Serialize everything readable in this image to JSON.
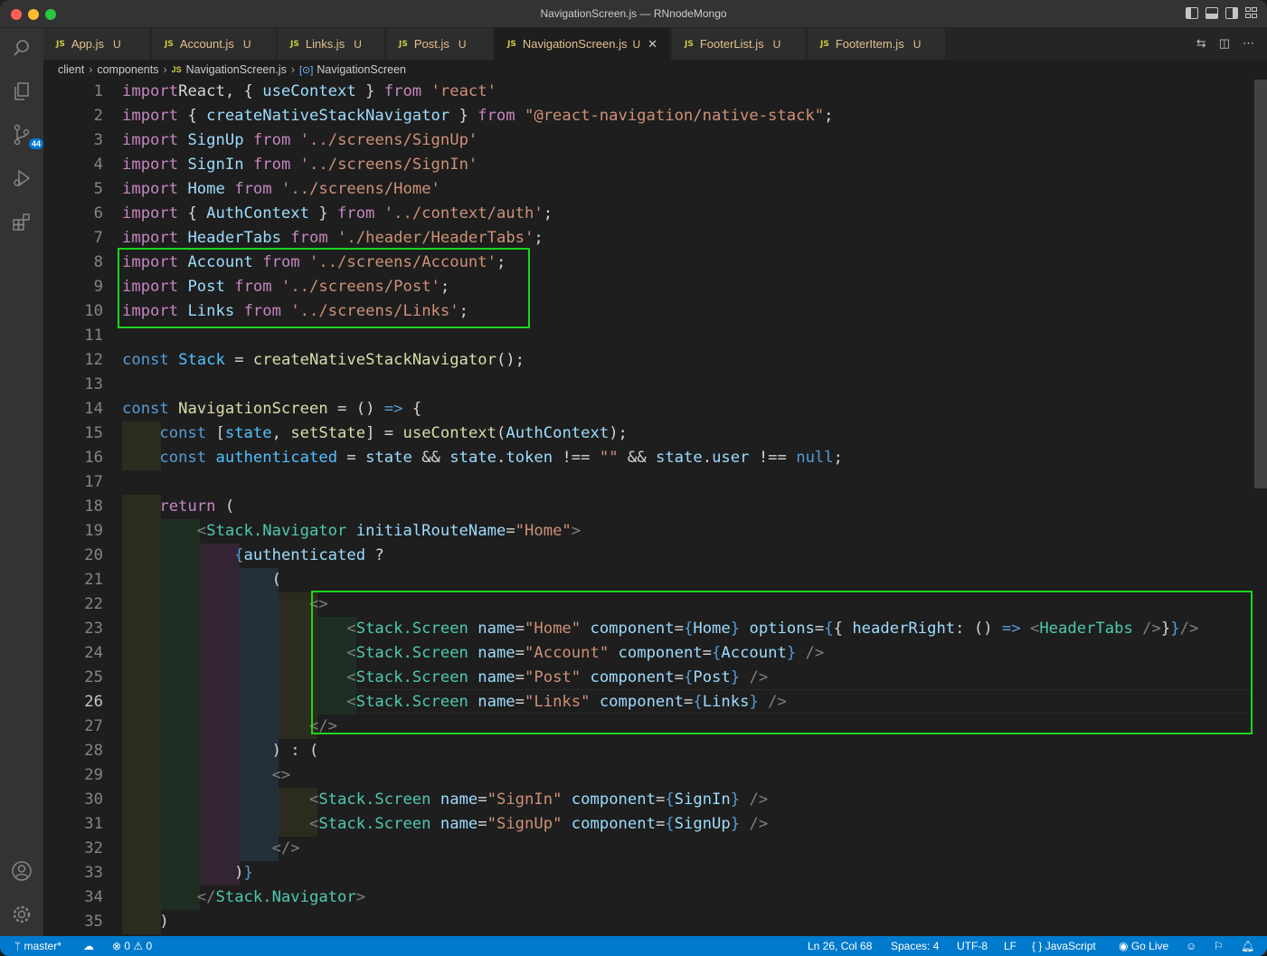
{
  "window": {
    "title": "NavigationScreen.js — RNnodeMongo"
  },
  "activity": {
    "scm_badge": "44"
  },
  "tabs": [
    {
      "label": "App.js",
      "status": "U"
    },
    {
      "label": "Account.js",
      "status": "U"
    },
    {
      "label": "Links.js",
      "status": "U"
    },
    {
      "label": "Post.js",
      "status": "U"
    },
    {
      "label": "NavigationScreen.js",
      "status": "U"
    },
    {
      "label": "FooterList.js",
      "status": "U"
    },
    {
      "label": "FooterItem.js",
      "status": "U"
    }
  ],
  "tab_file_icon": "JS",
  "breadcrumb": [
    "client",
    "components",
    "NavigationScreen.js",
    "NavigationScreen"
  ],
  "editor": {
    "line_numbers": [
      "1",
      "2",
      "3",
      "4",
      "5",
      "6",
      "7",
      "8",
      "9",
      "10",
      "11",
      "12",
      "13",
      "14",
      "15",
      "16",
      "17",
      "18",
      "19",
      "20",
      "21",
      "22",
      "23",
      "24",
      "25",
      "26",
      "27",
      "28",
      "29",
      "30",
      "31",
      "32",
      "33",
      "34",
      "35"
    ],
    "lines": [
      [
        [
          "imp",
          "import"
        ],
        [
          "",
          "React, { "
        ],
        [
          "v",
          "useContext"
        ],
        [
          "",
          " } "
        ],
        [
          "imp",
          "from"
        ],
        [
          "",
          " "
        ],
        [
          "s",
          "'react'"
        ]
      ],
      [
        [
          "imp",
          "import"
        ],
        [
          "",
          " { "
        ],
        [
          "v",
          "createNativeStackNavigator"
        ],
        [
          "",
          " } "
        ],
        [
          "imp",
          "from"
        ],
        [
          "",
          " "
        ],
        [
          "s",
          "\"@react-navigation/native-stack\""
        ],
        [
          "",
          ";"
        ]
      ],
      [
        [
          "imp",
          "import"
        ],
        [
          "",
          " "
        ],
        [
          "v",
          "SignUp"
        ],
        [
          "",
          " "
        ],
        [
          "imp",
          "from"
        ],
        [
          "",
          " "
        ],
        [
          "s",
          "'../screens/SignUp'"
        ]
      ],
      [
        [
          "imp",
          "import"
        ],
        [
          "",
          " "
        ],
        [
          "v",
          "SignIn"
        ],
        [
          "",
          " "
        ],
        [
          "imp",
          "from"
        ],
        [
          "",
          " "
        ],
        [
          "s",
          "'../screens/SignIn'"
        ]
      ],
      [
        [
          "imp",
          "import"
        ],
        [
          "",
          " "
        ],
        [
          "v",
          "Home"
        ],
        [
          "",
          " "
        ],
        [
          "imp",
          "from"
        ],
        [
          "",
          " "
        ],
        [
          "s",
          "'../screens/Home'"
        ]
      ],
      [
        [
          "imp",
          "import"
        ],
        [
          "",
          " { "
        ],
        [
          "v",
          "AuthContext"
        ],
        [
          "",
          " } "
        ],
        [
          "imp",
          "from"
        ],
        [
          "",
          " "
        ],
        [
          "s",
          "'../context/auth'"
        ],
        [
          "",
          ";"
        ]
      ],
      [
        [
          "imp",
          "import"
        ],
        [
          "",
          " "
        ],
        [
          "v",
          "HeaderTabs"
        ],
        [
          "",
          " "
        ],
        [
          "imp",
          "from"
        ],
        [
          "",
          " "
        ],
        [
          "s",
          "'./header/HeaderTabs'"
        ],
        [
          "",
          ";"
        ]
      ],
      [
        [
          "imp",
          "import"
        ],
        [
          "",
          " "
        ],
        [
          "v",
          "Account"
        ],
        [
          "",
          " "
        ],
        [
          "imp",
          "from"
        ],
        [
          "",
          " "
        ],
        [
          "s",
          "'../screens/Account'"
        ],
        [
          "",
          ";"
        ]
      ],
      [
        [
          "imp",
          "import"
        ],
        [
          "",
          " "
        ],
        [
          "v",
          "Post"
        ],
        [
          "",
          " "
        ],
        [
          "imp",
          "from"
        ],
        [
          "",
          " "
        ],
        [
          "s",
          "'../screens/Post'"
        ],
        [
          "",
          ";"
        ]
      ],
      [
        [
          "imp",
          "import"
        ],
        [
          "",
          " "
        ],
        [
          "v",
          "Links"
        ],
        [
          "",
          " "
        ],
        [
          "imp",
          "from"
        ],
        [
          "",
          " "
        ],
        [
          "s",
          "'../screens/Links'"
        ],
        [
          "",
          ";"
        ]
      ],
      [],
      [
        [
          "k",
          "const"
        ],
        [
          "",
          " "
        ],
        [
          "c",
          "Stack"
        ],
        [
          "",
          " = "
        ],
        [
          "f",
          "createNativeStackNavigator"
        ],
        [
          "",
          "();"
        ]
      ],
      [],
      [
        [
          "k",
          "const"
        ],
        [
          "",
          " "
        ],
        [
          "f",
          "NavigationScreen"
        ],
        [
          "",
          " = () "
        ],
        [
          "k",
          "=>"
        ],
        [
          "",
          " {"
        ]
      ],
      [
        [
          "",
          "    "
        ],
        [
          "k",
          "const"
        ],
        [
          "",
          " ["
        ],
        [
          "c",
          "state"
        ],
        [
          "",
          ", "
        ],
        [
          "f",
          "setState"
        ],
        [
          "",
          "] = "
        ],
        [
          "f",
          "useContext"
        ],
        [
          "",
          "("
        ],
        [
          "v",
          "AuthContext"
        ],
        [
          "",
          ");"
        ]
      ],
      [
        [
          "",
          "    "
        ],
        [
          "k",
          "const"
        ],
        [
          "",
          " "
        ],
        [
          "c",
          "authenticated"
        ],
        [
          "",
          " = "
        ],
        [
          "v",
          "state"
        ],
        [
          "",
          " && "
        ],
        [
          "v",
          "state"
        ],
        [
          "",
          "."
        ],
        [
          "v",
          "token"
        ],
        [
          "",
          " !== "
        ],
        [
          "s",
          "\"\""
        ],
        [
          "",
          " && "
        ],
        [
          "v",
          "state"
        ],
        [
          "",
          "."
        ],
        [
          "v",
          "user"
        ],
        [
          "",
          " !== "
        ],
        [
          "k",
          "null"
        ],
        [
          "",
          ";"
        ]
      ],
      [],
      [
        [
          "",
          "    "
        ],
        [
          "imp",
          "return"
        ],
        [
          "",
          " ("
        ]
      ],
      [
        [
          "",
          "        "
        ],
        [
          "tag",
          "<"
        ],
        [
          "t",
          "Stack.Navigator"
        ],
        [
          "",
          " "
        ],
        [
          "v",
          "initialRouteName"
        ],
        [
          "",
          "="
        ],
        [
          "s",
          "\"Home\""
        ],
        [
          "tag",
          ">"
        ]
      ],
      [
        [
          "",
          "            "
        ],
        [
          "k",
          "{"
        ],
        [
          "v",
          "authenticated"
        ],
        [
          "",
          " ?"
        ]
      ],
      [
        [
          "",
          "                ("
        ]
      ],
      [
        [
          "",
          "                    "
        ],
        [
          "tag",
          "<>"
        ]
      ],
      [
        [
          "",
          "                        "
        ],
        [
          "tag",
          "<"
        ],
        [
          "t",
          "Stack.Screen"
        ],
        [
          "",
          " "
        ],
        [
          "v",
          "name"
        ],
        [
          "",
          "="
        ],
        [
          "s",
          "\"Home\""
        ],
        [
          "",
          " "
        ],
        [
          "v",
          "component"
        ],
        [
          "",
          "="
        ],
        [
          "k",
          "{"
        ],
        [
          "v",
          "Home"
        ],
        [
          "k",
          "}"
        ],
        [
          "",
          " "
        ],
        [
          "v",
          "options"
        ],
        [
          "",
          "="
        ],
        [
          "k",
          "{"
        ],
        [
          "",
          "{ "
        ],
        [
          "v",
          "headerRight"
        ],
        [
          "",
          ": () "
        ],
        [
          "k",
          "=>"
        ],
        [
          "",
          " "
        ],
        [
          "tag",
          "<"
        ],
        [
          "t",
          "HeaderTabs"
        ],
        [
          "",
          " "
        ],
        [
          "tag",
          "/>"
        ],
        [
          "",
          "}"
        ],
        [
          "k",
          "}"
        ],
        [
          "tag",
          "/>"
        ]
      ],
      [
        [
          "",
          "                        "
        ],
        [
          "tag",
          "<"
        ],
        [
          "t",
          "Stack.Screen"
        ],
        [
          "",
          " "
        ],
        [
          "v",
          "name"
        ],
        [
          "",
          "="
        ],
        [
          "s",
          "\"Account\""
        ],
        [
          "",
          " "
        ],
        [
          "v",
          "component"
        ],
        [
          "",
          "="
        ],
        [
          "k",
          "{"
        ],
        [
          "v",
          "Account"
        ],
        [
          "k",
          "}"
        ],
        [
          "",
          " "
        ],
        [
          "tag",
          "/>"
        ]
      ],
      [
        [
          "",
          "                        "
        ],
        [
          "tag",
          "<"
        ],
        [
          "t",
          "Stack.Screen"
        ],
        [
          "",
          " "
        ],
        [
          "v",
          "name"
        ],
        [
          "",
          "="
        ],
        [
          "s",
          "\"Post\""
        ],
        [
          "",
          " "
        ],
        [
          "v",
          "component"
        ],
        [
          "",
          "="
        ],
        [
          "k",
          "{"
        ],
        [
          "v",
          "Post"
        ],
        [
          "k",
          "}"
        ],
        [
          "",
          " "
        ],
        [
          "tag",
          "/>"
        ]
      ],
      [
        [
          "",
          "                        "
        ],
        [
          "tag",
          "<"
        ],
        [
          "t",
          "Stack.Screen"
        ],
        [
          "",
          " "
        ],
        [
          "v",
          "name"
        ],
        [
          "",
          "="
        ],
        [
          "s",
          "\"Links\""
        ],
        [
          "",
          " "
        ],
        [
          "v",
          "component"
        ],
        [
          "",
          "="
        ],
        [
          "k",
          "{"
        ],
        [
          "v",
          "Links"
        ],
        [
          "k",
          "}"
        ],
        [
          "",
          " "
        ],
        [
          "tag",
          "/>"
        ]
      ],
      [
        [
          "",
          "                    "
        ],
        [
          "tag",
          "</>"
        ]
      ],
      [
        [
          "",
          "                ) : ("
        ]
      ],
      [
        [
          "",
          "                "
        ],
        [
          "tag",
          "<>"
        ]
      ],
      [
        [
          "",
          "                    "
        ],
        [
          "tag",
          "<"
        ],
        [
          "t",
          "Stack.Screen"
        ],
        [
          "",
          " "
        ],
        [
          "v",
          "name"
        ],
        [
          "",
          "="
        ],
        [
          "s",
          "\"SignIn\""
        ],
        [
          "",
          " "
        ],
        [
          "v",
          "component"
        ],
        [
          "",
          "="
        ],
        [
          "k",
          "{"
        ],
        [
          "v",
          "SignIn"
        ],
        [
          "k",
          "}"
        ],
        [
          "",
          " "
        ],
        [
          "tag",
          "/>"
        ]
      ],
      [
        [
          "",
          "                    "
        ],
        [
          "tag",
          "<"
        ],
        [
          "t",
          "Stack.Screen"
        ],
        [
          "",
          " "
        ],
        [
          "v",
          "name"
        ],
        [
          "",
          "="
        ],
        [
          "s",
          "\"SignUp\""
        ],
        [
          "",
          " "
        ],
        [
          "v",
          "component"
        ],
        [
          "",
          "="
        ],
        [
          "k",
          "{"
        ],
        [
          "v",
          "SignUp"
        ],
        [
          "k",
          "}"
        ],
        [
          "",
          " "
        ],
        [
          "tag",
          "/>"
        ]
      ],
      [
        [
          "",
          "                "
        ],
        [
          "tag",
          "</>"
        ]
      ],
      [
        [
          "",
          "            )"
        ],
        [
          "k",
          "}"
        ]
      ],
      [
        [
          "",
          "        "
        ],
        [
          "tag",
          "</"
        ],
        [
          "t",
          "Stack.Navigator"
        ],
        [
          "tag",
          ">"
        ]
      ],
      [
        [
          "",
          "    )"
        ]
      ]
    ]
  },
  "status": {
    "branch": "master*",
    "problems_errors": "0",
    "problems_warnings": "0",
    "cursor": "Ln 26, Col 68",
    "spaces": "Spaces: 4",
    "encoding": "UTF-8",
    "eol": "LF",
    "language": "JavaScript",
    "golive": "Go Live"
  },
  "colors": {
    "accent": "#007acc",
    "highlight_box": "#1ed51e"
  }
}
